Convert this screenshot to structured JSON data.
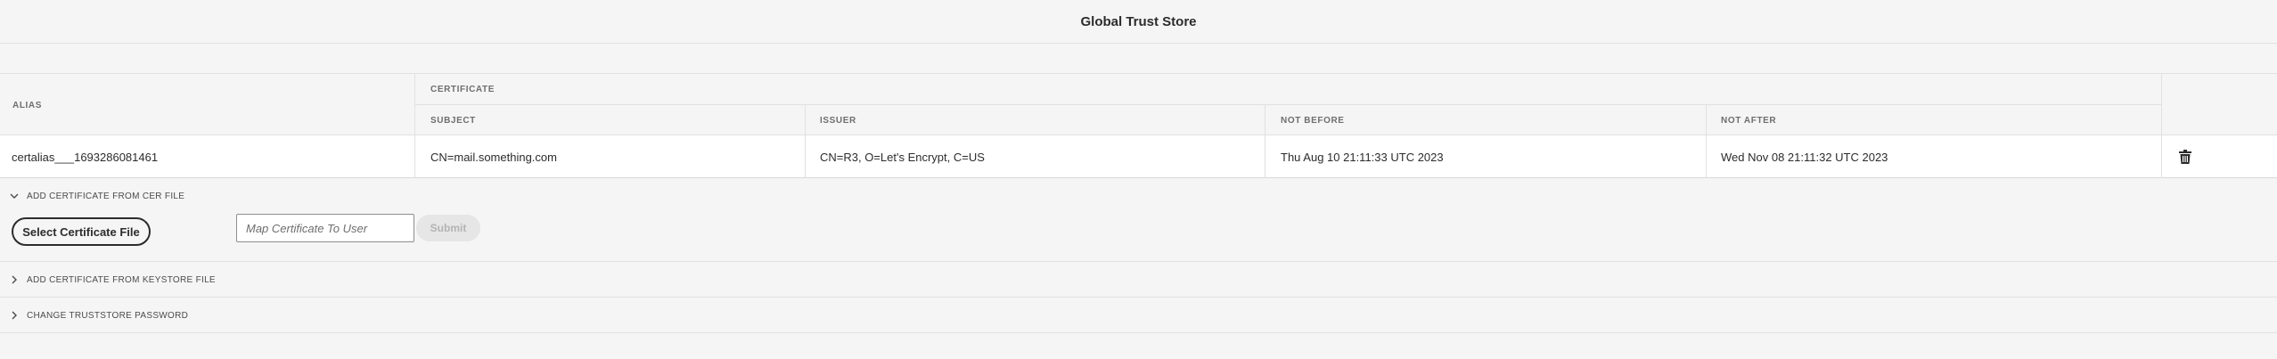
{
  "header": {
    "title": "Global Trust Store"
  },
  "table": {
    "headers": {
      "alias": "ALIAS",
      "certificate": "CERTIFICATE",
      "subject": "SUBJECT",
      "issuer": "ISSUER",
      "not_before": "NOT BEFORE",
      "not_after": "NOT AFTER"
    },
    "rows": [
      {
        "alias": "certalias___1693286081461",
        "subject": "CN=mail.something.com",
        "issuer": "CN=R3, O=Let's Encrypt, C=US",
        "not_before": "Thu Aug 10 21:11:33 UTC 2023",
        "not_after": "Wed Nov 08 21:11:32 UTC 2023"
      }
    ]
  },
  "sections": {
    "cer": {
      "label": "ADD CERTIFICATE FROM CER FILE",
      "expanded": true,
      "select_button": "Select Certificate File",
      "map_placeholder": "Map Certificate To User",
      "submit_label": "Submit"
    },
    "keystore": {
      "label": "ADD CERTIFICATE FROM KEYSTORE FILE",
      "expanded": false
    },
    "password": {
      "label": "CHANGE TRUSTSTORE PASSWORD",
      "expanded": false
    }
  },
  "icons": {
    "delete": "trash-icon",
    "expanded": "chevron-down-icon",
    "collapsed": "chevron-right-icon"
  }
}
